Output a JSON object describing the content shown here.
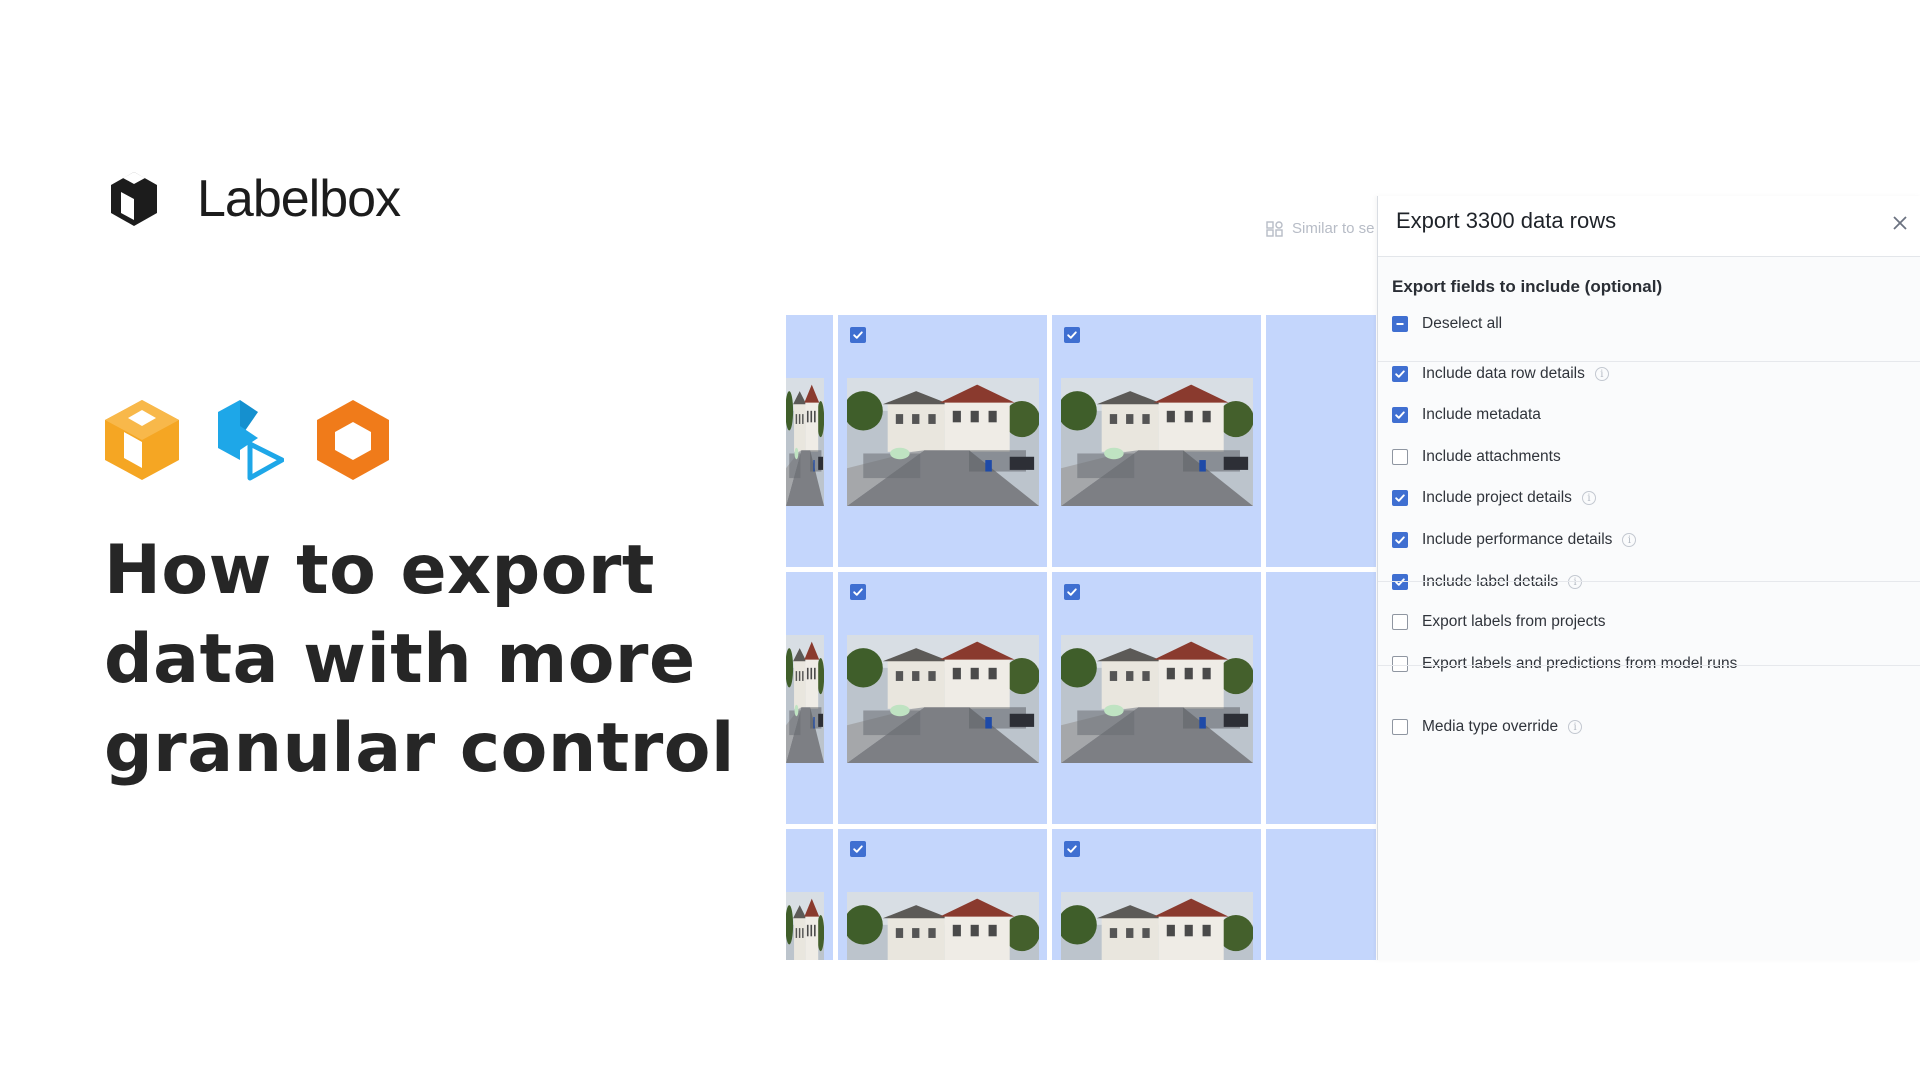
{
  "brand": {
    "name": "Labelbox"
  },
  "product_icons": [
    "catalog-icon",
    "annotate-icon",
    "model-icon"
  ],
  "headline": {
    "line1": "How to export",
    "line2": "data with more",
    "line3": "granular control"
  },
  "toolbar": {
    "similar_label": "Similar to se"
  },
  "panel": {
    "title": "Export 3300 data rows",
    "section_title": "Export fields to include (optional)",
    "deselect_all": "Deselect all",
    "options": [
      {
        "label": "Include data row details",
        "checked": true,
        "info": true
      },
      {
        "label": "Include metadata",
        "checked": true,
        "info": false
      },
      {
        "label": "Include attachments",
        "checked": false,
        "info": false
      },
      {
        "label": "Include project details",
        "checked": true,
        "info": true
      },
      {
        "label": "Include performance details",
        "checked": true,
        "info": true
      },
      {
        "label": "Include label details",
        "checked": true,
        "info": true
      }
    ],
    "export_options": [
      {
        "label": "Export labels from projects",
        "checked": false
      },
      {
        "label": "Export labels and predictions from model runs",
        "checked": false
      }
    ],
    "media_override": {
      "label": "Media type override",
      "checked": false,
      "info": true
    }
  },
  "colors": {
    "accent": "#3f6fd1",
    "selected_cell": "#c4d6fc",
    "icon_yellow": "#f5a623",
    "icon_blue": "#1ea7e8",
    "icon_orange": "#f07b1a"
  }
}
